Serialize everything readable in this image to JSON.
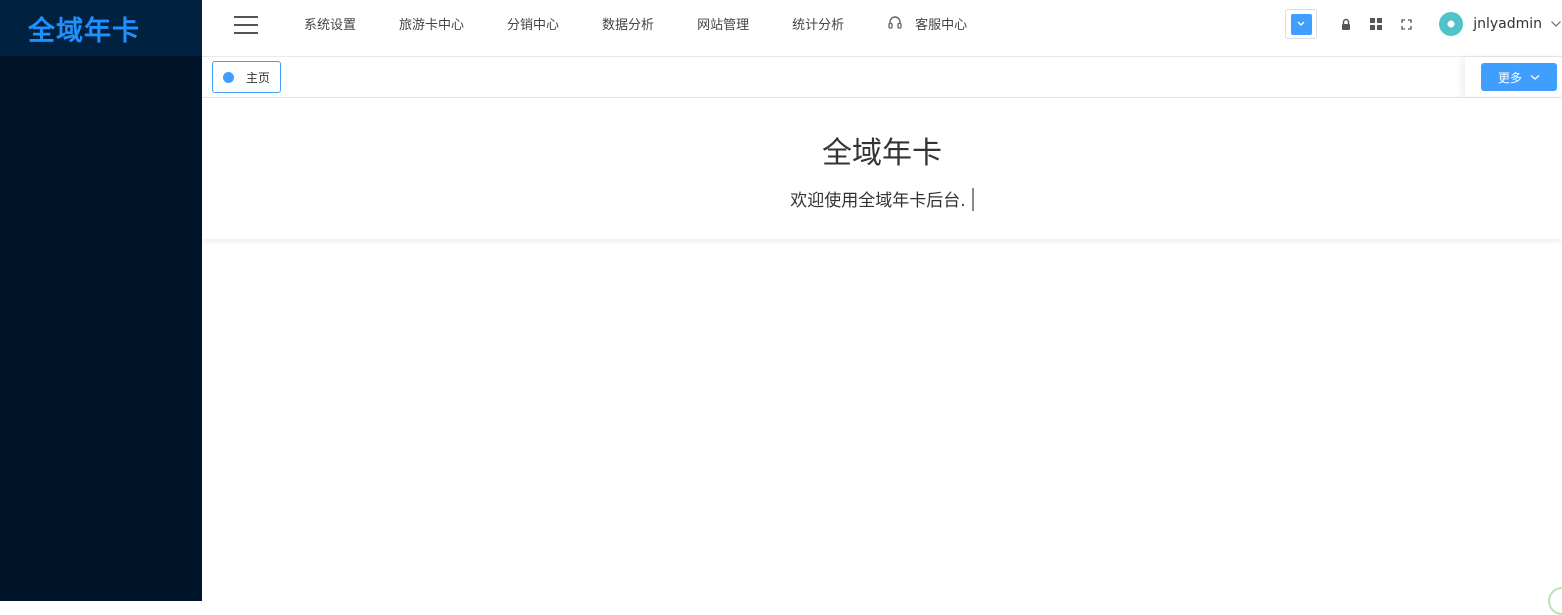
{
  "brand": {
    "title": "全域年卡",
    "color": "#1e90ff"
  },
  "sidebar": {
    "background": "#001529"
  },
  "nav": {
    "items": [
      {
        "label": "系统设置"
      },
      {
        "label": "旅游卡中心"
      },
      {
        "label": "分销中心"
      },
      {
        "label": "数据分析"
      },
      {
        "label": "网站管理"
      },
      {
        "label": "统计分析"
      },
      {
        "label": "客服中心",
        "icon": "headset-icon"
      }
    ]
  },
  "toolbar": {
    "theme_icon": "chevron-down-icon",
    "lock_icon": "lock-icon",
    "grid_icon": "grid-icon",
    "fullscreen_icon": "fullscreen-icon"
  },
  "user": {
    "name": "jnlyadmin"
  },
  "tabs": {
    "home_label": "主页",
    "more_label": "更多"
  },
  "welcome": {
    "title": "全域年卡",
    "message": "欢迎使用全域年卡后台."
  },
  "colors": {
    "accent": "#409eff"
  }
}
